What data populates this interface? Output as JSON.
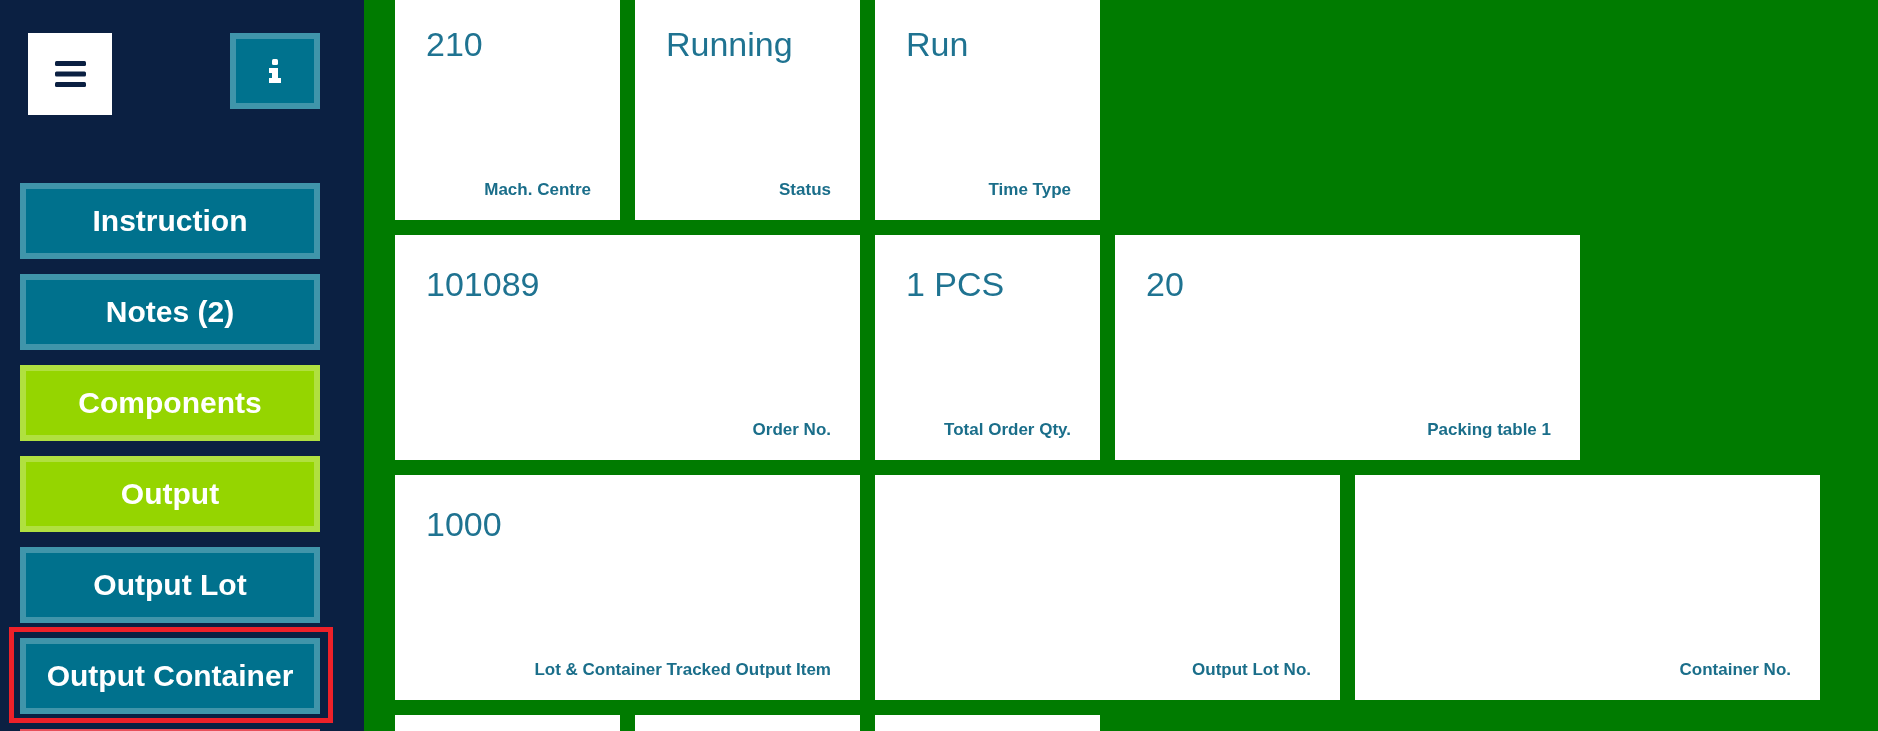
{
  "sidebar": {
    "buttons": [
      {
        "label": "Instruction",
        "color": "#4095aa",
        "selected": false
      },
      {
        "label": "Notes (2)",
        "color": "#4095aa",
        "selected": false
      },
      {
        "label": "Components",
        "color": "#b0e040",
        "selected": false
      },
      {
        "label": "Output",
        "color": "#b0e040",
        "selected": false
      },
      {
        "label": "Output Lot",
        "color": "#4095aa",
        "selected": false
      },
      {
        "label": "Output Container",
        "color": "#4095aa",
        "selected": true
      },
      {
        "color": "#e8505a",
        "selected": false
      }
    ]
  },
  "rows": [
    {
      "tiles": [
        {
          "kind": "small",
          "value": "210",
          "label": "Mach. Centre"
        },
        {
          "kind": "small",
          "value": "Running",
          "label": "Status"
        },
        {
          "kind": "small",
          "value": "Run",
          "label": "Time Type"
        }
      ]
    },
    {
      "tiles": [
        {
          "kind": "wide",
          "value": "101089",
          "label": "Order No."
        },
        {
          "kind": "small",
          "value": "1 PCS",
          "label": "Total Order Qty."
        },
        {
          "kind": "wide",
          "value": "20",
          "label": "Packing table 1"
        }
      ]
    },
    {
      "tiles": [
        {
          "kind": "wide",
          "value": "1000",
          "label": "Lot & Container Tracked Output Item"
        },
        {
          "kind": "wide",
          "label": "Output Lot No."
        },
        {
          "kind": "wide",
          "label": "Container No."
        }
      ]
    },
    {
      "tiles": [
        {
          "kind": "small"
        },
        {
          "kind": "small"
        },
        {
          "kind": "small"
        }
      ]
    }
  ]
}
